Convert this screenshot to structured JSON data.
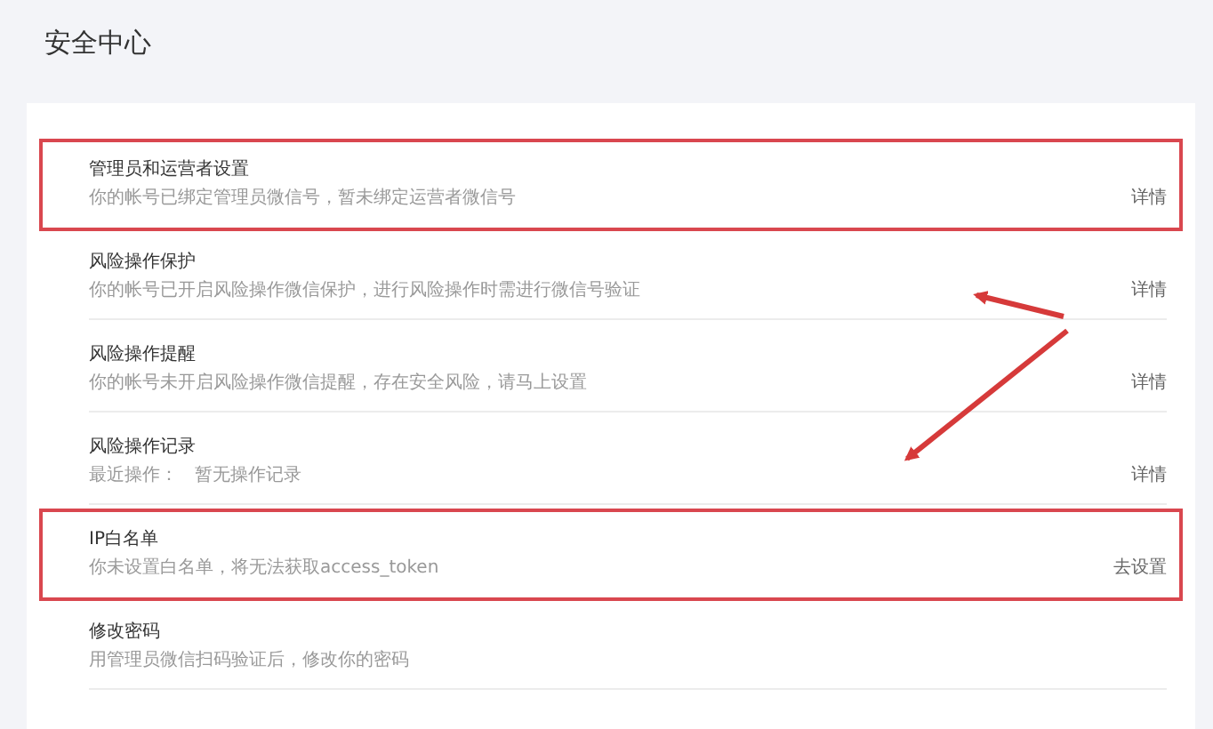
{
  "page_title": "安全中心",
  "items": [
    {
      "title": "管理员和运营者设置",
      "description": "你的帐号已绑定管理员微信号，暂未绑定运营者微信号",
      "action": "详情",
      "highlighted": true
    },
    {
      "title": "风险操作保护",
      "description": "你的帐号已开启风险操作微信保护，进行风险操作时需进行微信号验证",
      "action": "详情",
      "highlighted": false
    },
    {
      "title": "风险操作提醒",
      "description": "你的帐号未开启风险操作微信提醒，存在安全风险，请马上设置",
      "action": "详情",
      "highlighted": false
    },
    {
      "title": "风险操作记录",
      "description": "最近操作：   暂无操作记录",
      "action": "详情",
      "highlighted": false
    },
    {
      "title": "IP白名单",
      "description": "你未设置白名单，将无法获取access_token",
      "action": "去设置",
      "highlighted": true
    },
    {
      "title": "修改密码",
      "description": "用管理员微信扫码验证后，修改你的密码",
      "highlighted": false
    }
  ]
}
